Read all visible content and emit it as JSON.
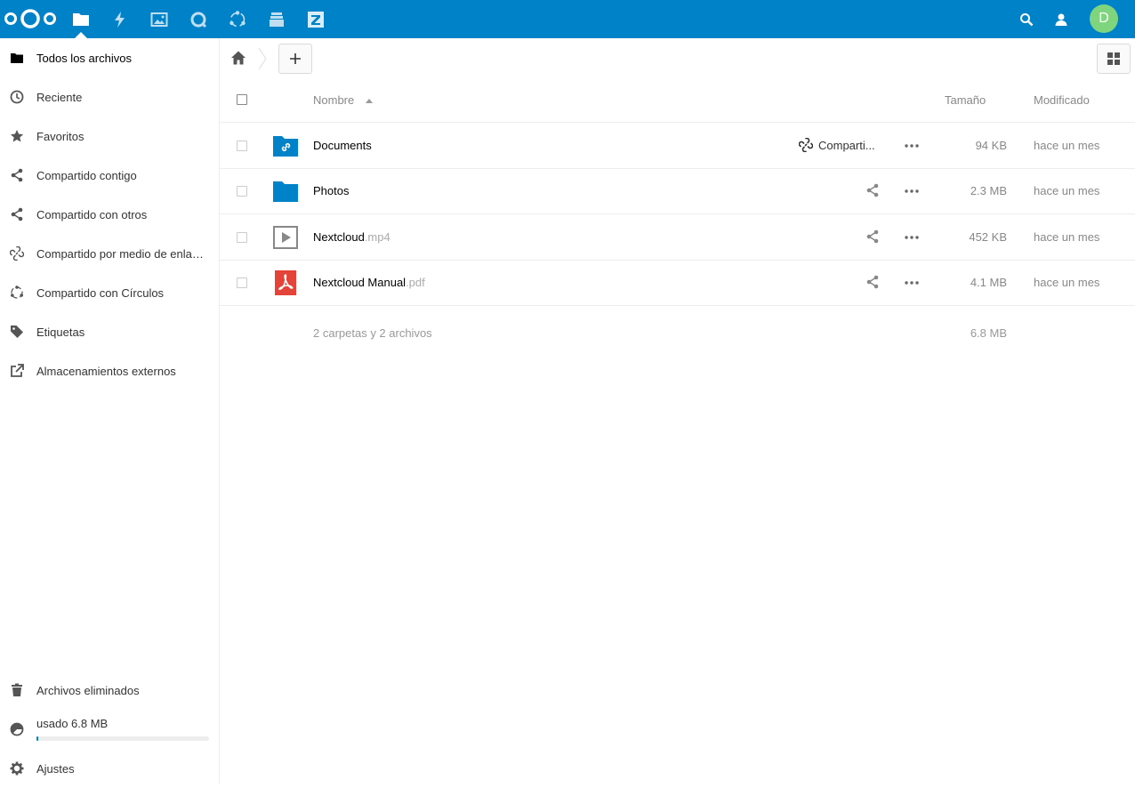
{
  "header": {
    "apps": [
      {
        "name": "files-icon"
      },
      {
        "name": "activity-icon"
      },
      {
        "name": "photos-icon"
      },
      {
        "name": "talk-icon"
      },
      {
        "name": "circles-icon"
      },
      {
        "name": "deck-icon"
      },
      {
        "name": "zammad-icon"
      }
    ],
    "avatar_letter": "D",
    "accent": "#0082c9"
  },
  "sidebar": {
    "items": [
      {
        "label": "Todos los archivos",
        "icon": "folder-icon"
      },
      {
        "label": "Reciente",
        "icon": "clock-icon"
      },
      {
        "label": "Favoritos",
        "icon": "star-icon"
      },
      {
        "label": "Compartido contigo",
        "icon": "share-icon"
      },
      {
        "label": "Compartido con otros",
        "icon": "share-icon"
      },
      {
        "label": "Compartido por medio de enlaces",
        "icon": "link-icon"
      },
      {
        "label": "Compartido con Círculos",
        "icon": "circles-icon"
      },
      {
        "label": "Etiquetas",
        "icon": "tag-icon"
      },
      {
        "label": "Almacenamientos externos",
        "icon": "external-icon"
      }
    ],
    "trash_label": "Archivos eliminados",
    "quota_label": "usado 6.8 MB",
    "settings_label": "Ajustes"
  },
  "table": {
    "col_name": "Nombre",
    "col_size": "Tamaño",
    "col_modified": "Modificado",
    "rows": [
      {
        "name": "Documents",
        "ext": "",
        "type": "shared-folder",
        "share_label": "Comparti...",
        "size": "94 KB",
        "modified": "hace un mes"
      },
      {
        "name": "Photos",
        "ext": "",
        "type": "folder",
        "share_label": "",
        "size": "2.3 MB",
        "modified": "hace un mes"
      },
      {
        "name": "Nextcloud",
        "ext": ".mp4",
        "type": "video",
        "share_label": "",
        "size": "452 KB",
        "modified": "hace un mes"
      },
      {
        "name": "Nextcloud Manual",
        "ext": ".pdf",
        "type": "pdf",
        "share_label": "",
        "size": "4.1 MB",
        "modified": "hace un mes"
      }
    ],
    "summary_count": "2 carpetas y 2 archivos",
    "summary_size": "6.8 MB"
  }
}
